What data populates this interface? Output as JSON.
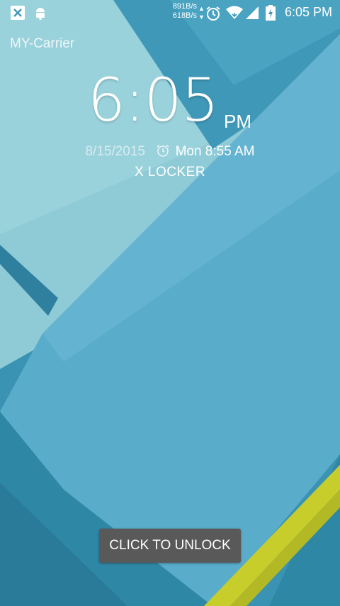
{
  "colors": {
    "wall_light": "#8fcbd6",
    "wall_mid": "#5aaccb",
    "wall_dark": "#2d86a5",
    "accent_yellow": "#cbd12e",
    "button_bg": "#595959"
  },
  "status_bar": {
    "left_icons": [
      "x-app-icon",
      "android-debug-icon"
    ],
    "upload_speed": "891B/s",
    "download_speed": "618B/s",
    "right_icons": [
      "alarm-icon",
      "wifi-icon",
      "signal-icon",
      "battery-charging-icon"
    ],
    "time": "6:05 PM"
  },
  "lockscreen": {
    "carrier": "MY-Carrier",
    "time": "6:05",
    "ampm": "PM",
    "date": "8/15/2015",
    "next_alarm": "Mon 8:55 AM",
    "app_name": "X LOCKER"
  },
  "unlock_button": {
    "label": "CLICK TO UNLOCK"
  }
}
